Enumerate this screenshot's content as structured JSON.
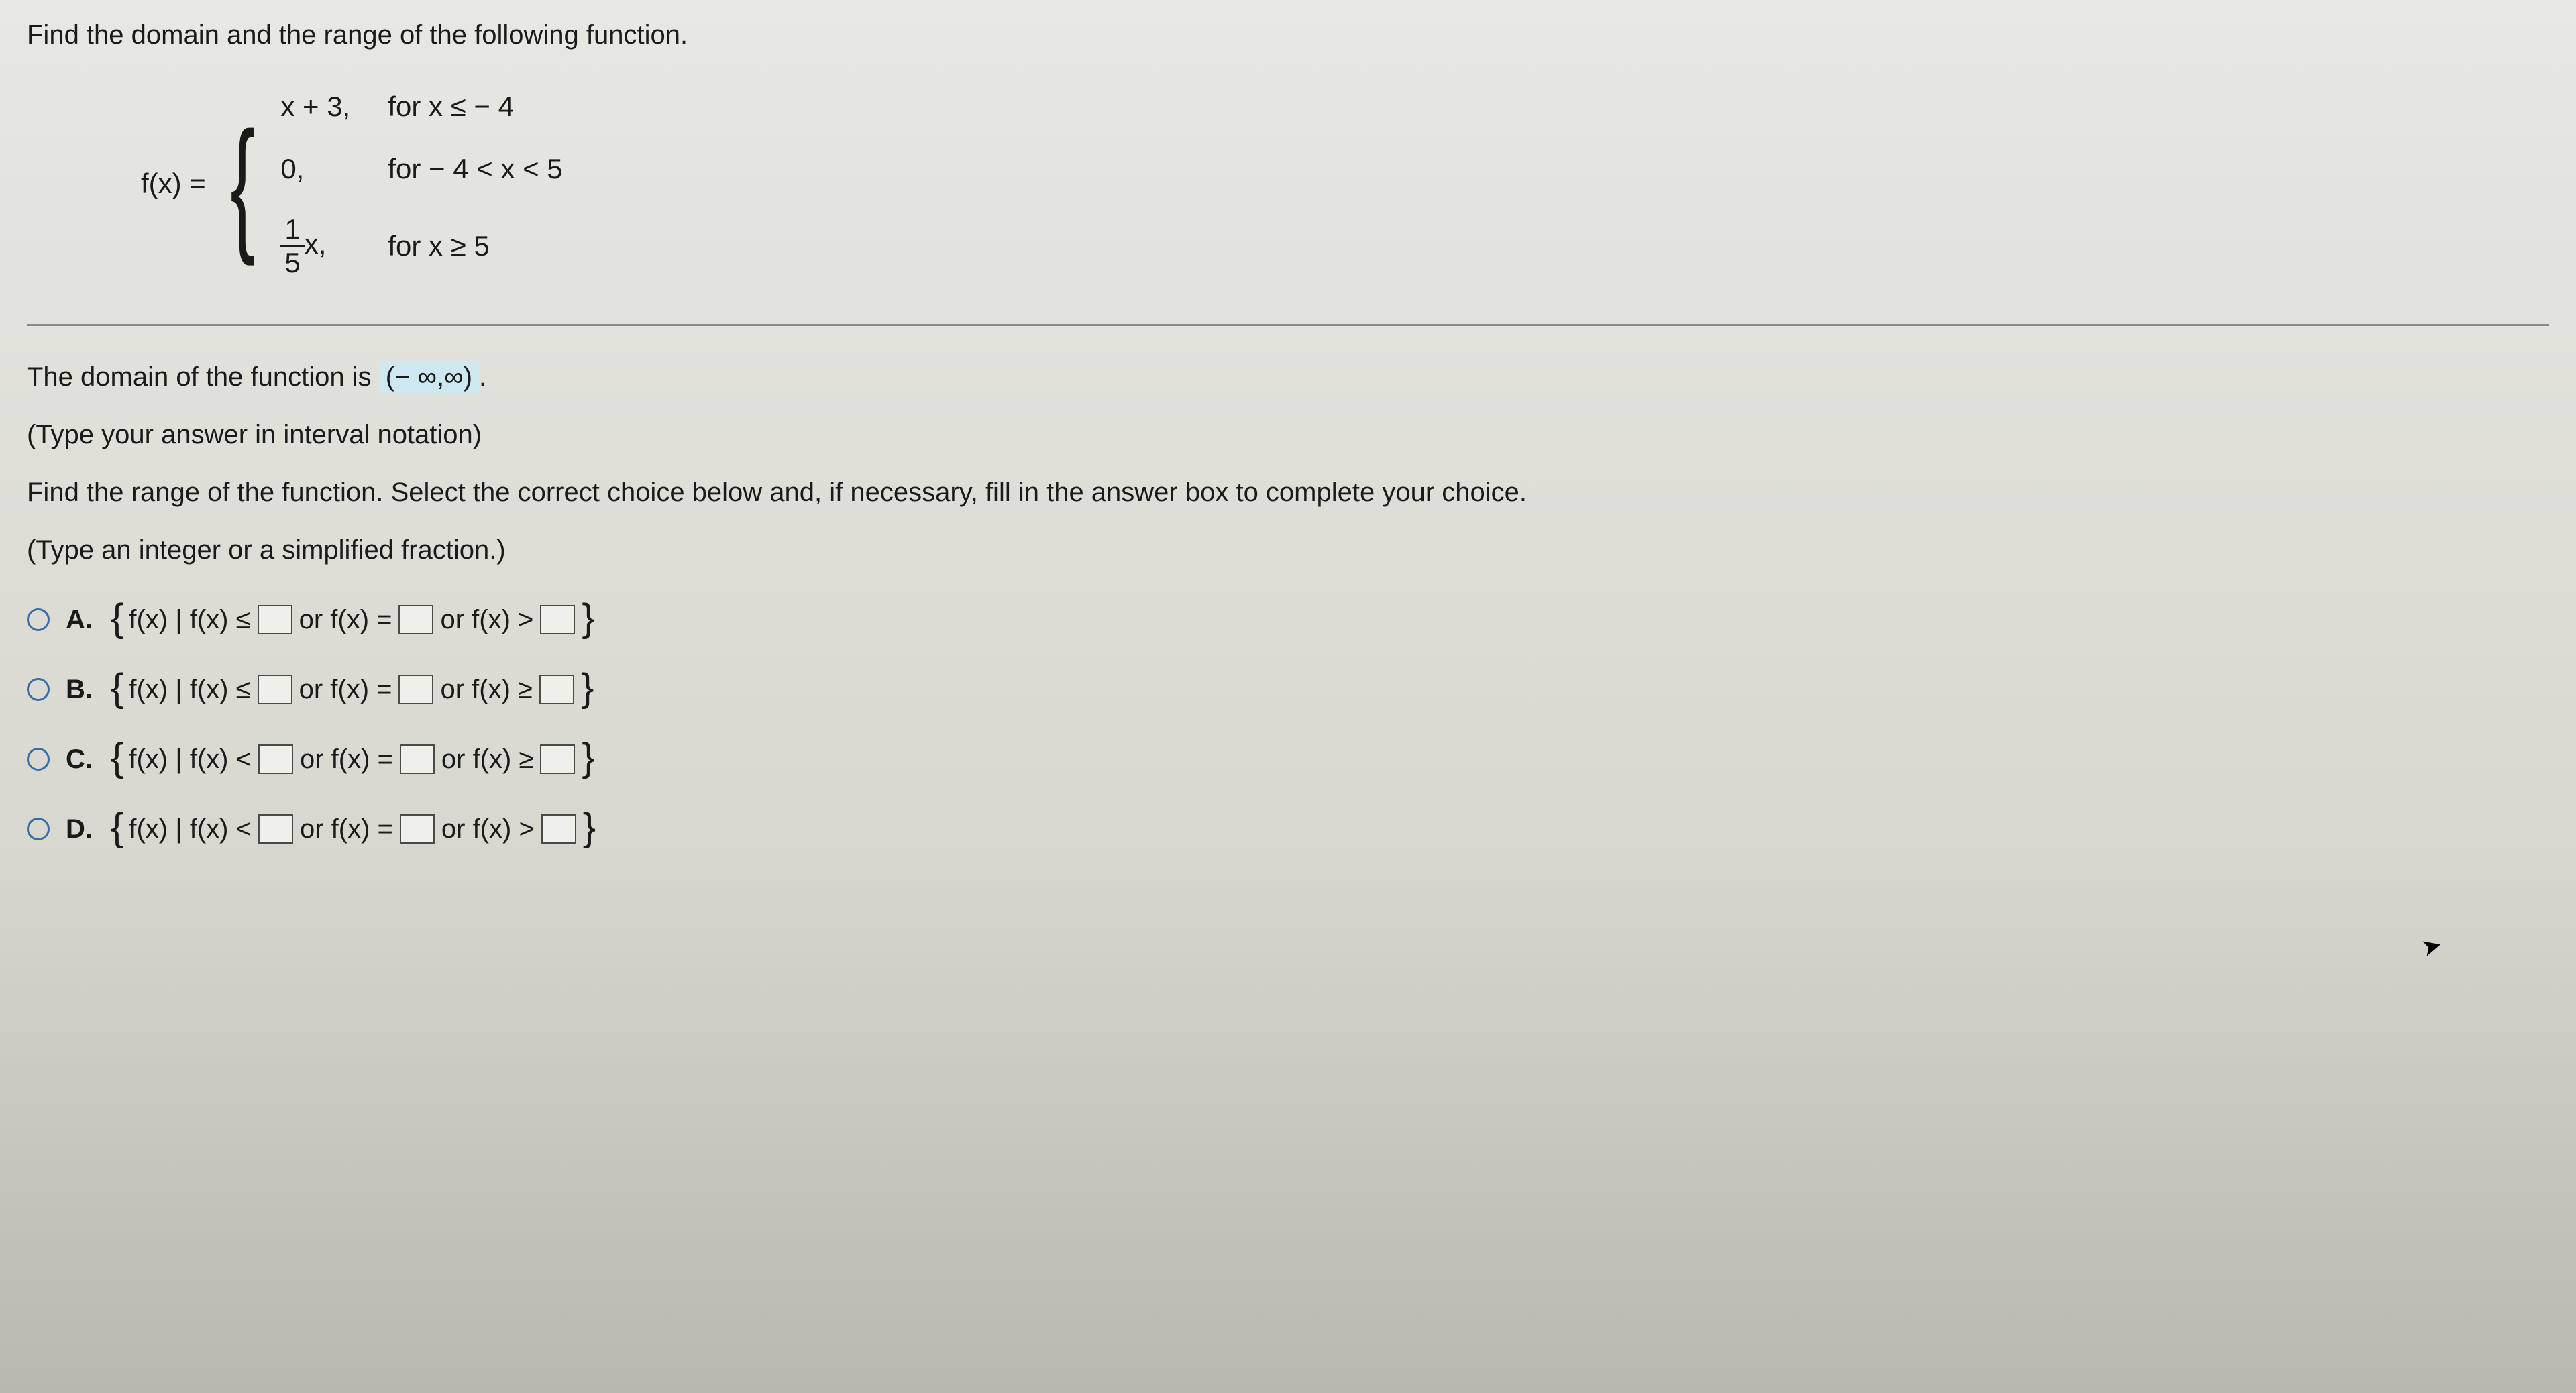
{
  "instruction": "Find the domain and the range of the following function.",
  "function": {
    "label": "f(x) =",
    "pieces": [
      {
        "expr": "x + 3,",
        "cond": "for x ≤ − 4"
      },
      {
        "expr": "0,",
        "cond": "for − 4 < x < 5"
      },
      {
        "expr_frac": {
          "num": "1",
          "den": "5"
        },
        "expr_tail": "x,",
        "cond": "for x ≥ 5"
      }
    ]
  },
  "domain_line": {
    "prefix": "The domain of the function is ",
    "answer": "(− ∞,∞)",
    "suffix": "."
  },
  "hint1": "(Type your answer in interval notation)",
  "range_prompt": "Find the range of the function. Select the correct choice below and, if necessary, fill in the answer box to complete your choice.",
  "hint2": "(Type an integer or a simplified fraction.)",
  "choices": [
    {
      "letter": "A.",
      "p1": "f(x) | f(x) ≤",
      "or1": "or f(x) =",
      "or2": "or f(x) >"
    },
    {
      "letter": "B.",
      "p1": "f(x) | f(x) ≤",
      "or1": "or f(x) =",
      "or2": "or f(x) ≥"
    },
    {
      "letter": "C.",
      "p1": "f(x) | f(x) <",
      "or1": "or f(x) =",
      "or2": "or f(x) ≥"
    },
    {
      "letter": "D.",
      "p1": "f(x) | f(x) <",
      "or1": "or f(x) =",
      "or2": "or f(x) >"
    }
  ]
}
